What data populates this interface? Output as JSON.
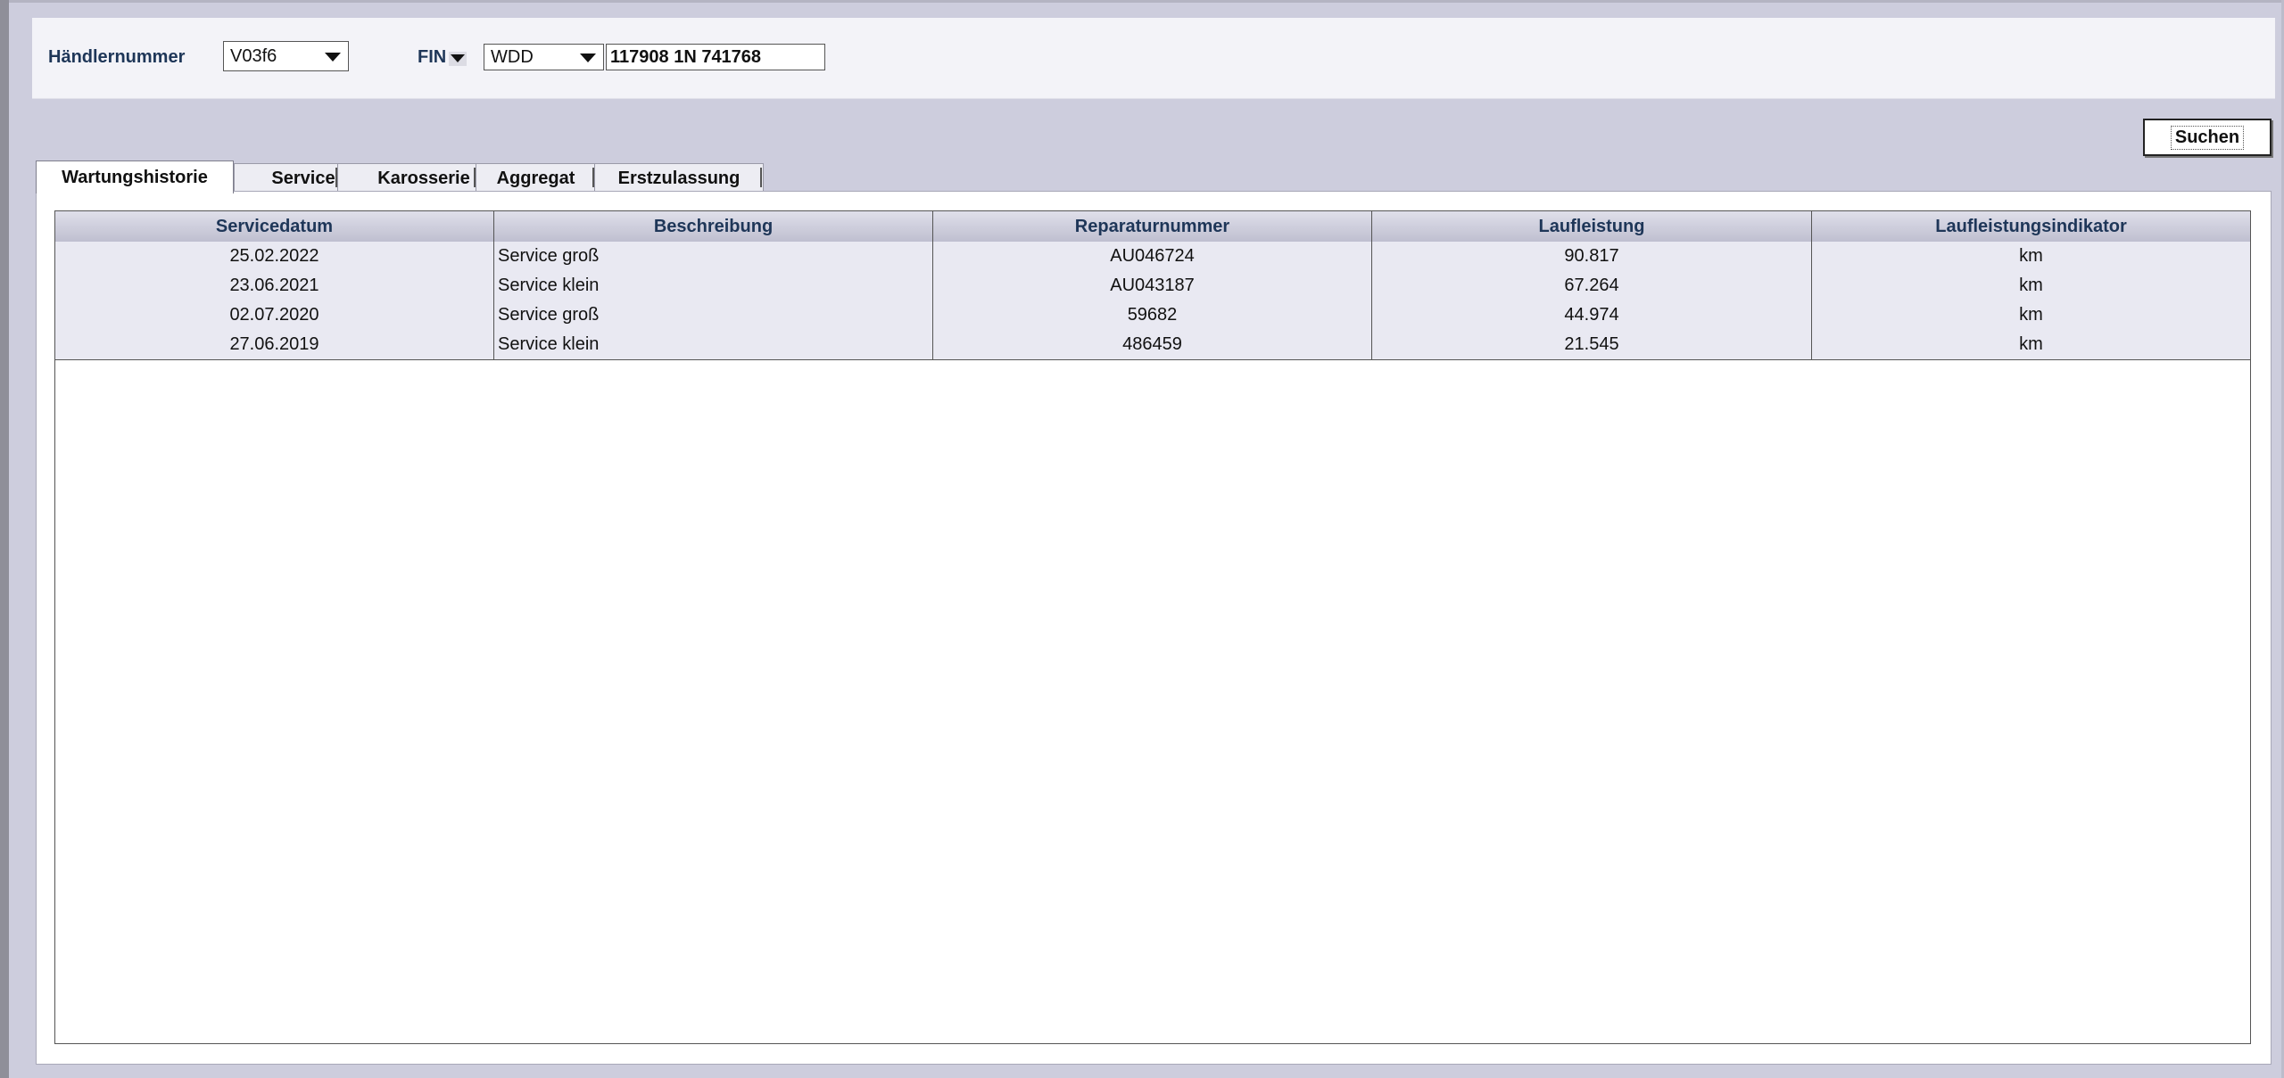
{
  "filters": {
    "dealer_label": "Händlernummer",
    "dealer_value": "V03f6",
    "fin_label": "FIN",
    "fin_prefix": "WDD",
    "fin_value": "117908 1N 741768"
  },
  "search_button": "Suchen",
  "tabs": [
    {
      "label": "Wartungshistorie",
      "active": true
    },
    {
      "label": "Service",
      "active": false
    },
    {
      "label": "Karosserie",
      "active": false
    },
    {
      "label": "Aggregat",
      "active": false
    },
    {
      "label": "Erstzulassung",
      "active": false
    }
  ],
  "table": {
    "columns": [
      "Servicedatum",
      "Beschreibung",
      "Reparaturnummer",
      "Laufleistung",
      "Laufleistungsindikator"
    ],
    "rows": [
      [
        "25.02.2022",
        "Service groß",
        "AU046724",
        "90.817",
        "km"
      ],
      [
        "23.06.2021",
        "Service klein",
        "AU043187",
        "67.264",
        "km"
      ],
      [
        "02.07.2020",
        "Service groß",
        "59682",
        "44.974",
        "km"
      ],
      [
        "27.06.2019",
        "Service klein",
        "486459",
        "21.545",
        "km"
      ]
    ]
  }
}
